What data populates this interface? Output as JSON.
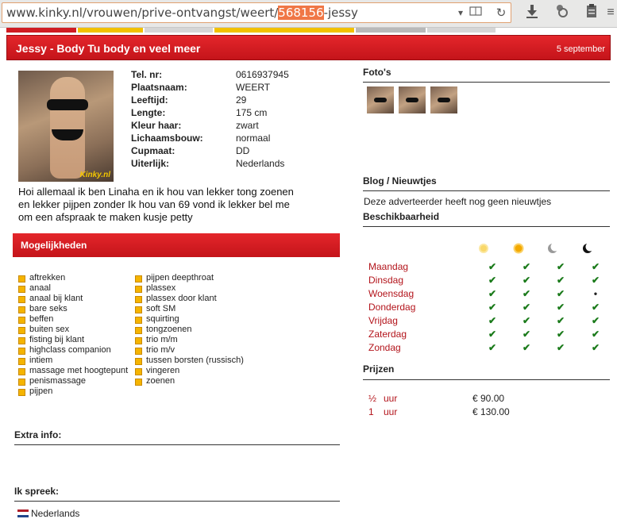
{
  "browser": {
    "url_prefix": "www.kinky.nl/vrouwen/prive-ontvangst/weert/",
    "url_highlight": "568156",
    "url_suffix": "-jessy"
  },
  "header": {
    "title": "Jessy - Body Tu body en veel meer",
    "date": "5 september"
  },
  "profile": {
    "photo_watermark": "Kinky.nl",
    "fields": [
      {
        "label": "Tel. nr:",
        "value": "0616937945"
      },
      {
        "label": "Plaatsnaam:",
        "value": "WEERT"
      },
      {
        "label": "Leeftijd:",
        "value": "29"
      },
      {
        "label": "Lengte:",
        "value": "175 cm"
      },
      {
        "label": "Kleur haar:",
        "value": "zwart"
      },
      {
        "label": "Lichaamsbouw:",
        "value": "normaal"
      },
      {
        "label": "Cupmaat:",
        "value": "DD"
      },
      {
        "label": "Uiterlijk:",
        "value": "Nederlands"
      }
    ],
    "description": "Hoi allemaal ik ben Linaha en ik hou van lekker tong zoenen en lekker pijpen zonder Ik hou van 69 vond ik lekker bel me om een afspraak te maken kusje petty"
  },
  "mogelijkheden": {
    "title": "Mogelijkheden",
    "col1": [
      "aftrekken",
      "anaal",
      "anaal bij klant",
      "bare seks",
      "beffen",
      "buiten sex",
      "fisting bij klant",
      "highclass companion",
      "intiem",
      "massage met hoogtepunt",
      "penismassage",
      "pijpen"
    ],
    "col2": [
      "pijpen deepthroat",
      "plassex",
      "plassex door klant",
      "soft SM",
      "squirting",
      "tongzoenen",
      "trio m/m",
      "trio m/v",
      "tussen borsten (russisch)",
      "vingeren",
      "zoenen"
    ]
  },
  "extra_info": {
    "title": "Extra info:"
  },
  "languages": {
    "title": "Ik spreek:",
    "items": [
      "Nederlands"
    ]
  },
  "photos": {
    "title": "Foto's"
  },
  "blog": {
    "title": "Blog / Nieuwtjes",
    "empty": "Deze adverteerder heeft nog geen nieuwtjes"
  },
  "availability": {
    "title": "Beschikbaarheid",
    "periods": [
      "morning-sun-icon",
      "afternoon-sun-icon",
      "evening-moon-icon",
      "night-moon-icon"
    ],
    "days": [
      {
        "name": "Maandag",
        "slots": [
          true,
          true,
          true,
          true
        ]
      },
      {
        "name": "Dinsdag",
        "slots": [
          true,
          true,
          true,
          true
        ]
      },
      {
        "name": "Woensdag",
        "slots": [
          true,
          true,
          true,
          false
        ]
      },
      {
        "name": "Donderdag",
        "slots": [
          true,
          true,
          true,
          true
        ]
      },
      {
        "name": "Vrijdag",
        "slots": [
          true,
          true,
          true,
          true
        ]
      },
      {
        "name": "Zaterdag",
        "slots": [
          true,
          true,
          true,
          true
        ]
      },
      {
        "name": "Zondag",
        "slots": [
          true,
          true,
          true,
          true
        ]
      }
    ],
    "check_glyph": "✔",
    "dot_glyph": "•"
  },
  "prices": {
    "title": "Prijzen",
    "rows": [
      {
        "qty": "½",
        "unit": "uur",
        "price": "€ 90.00"
      },
      {
        "qty": "1",
        "unit": "uur",
        "price": "€ 130.00"
      }
    ]
  },
  "colors": {
    "accent_red": "#d01c22",
    "day_red": "#b3141b",
    "check_green": "#1a7a1a",
    "bullet_orange": "#f5b400"
  }
}
